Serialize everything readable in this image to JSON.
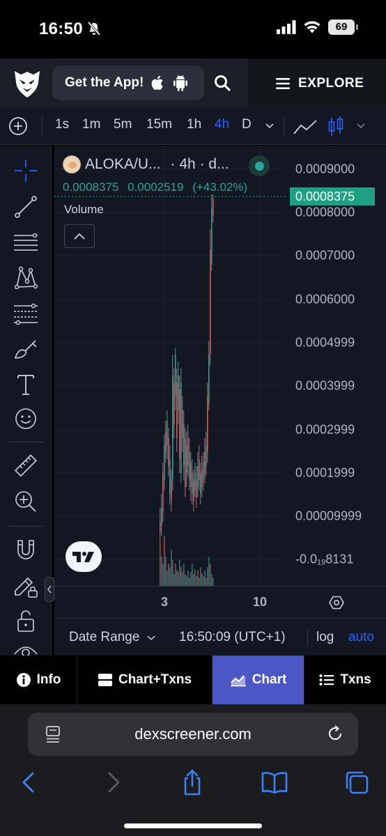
{
  "status_bar": {
    "time": "16:50",
    "battery": "69"
  },
  "header": {
    "get_app_label": "Get the App!",
    "explore_label": "EXPLORE"
  },
  "timeframes": {
    "items": [
      "1s",
      "1m",
      "5m",
      "15m",
      "1h",
      "4h",
      "D"
    ],
    "active": "4h"
  },
  "chart": {
    "symbol": "ALOKA/U...",
    "interval_meta": "· 4h · d...",
    "ohlc_close": "0.0008375",
    "change_abs": "0.0002519",
    "change_pct": "(+43.02%)",
    "volume_label": "Volume",
    "current_price": "0.0008375",
    "price_labels": [
      "0.0009000",
      "0.0008000",
      "0.0007000",
      "0.0006000",
      "0.0004999",
      "0.0003999",
      "0.0002999",
      "0.0001999",
      "0.00009999"
    ],
    "last_price_label_prefix": "-0.0",
    "last_price_label_sub": "19",
    "last_price_label_suffix": "8131",
    "time_labels": [
      "3",
      "10"
    ],
    "colors": {
      "up": "#26a69a",
      "down": "#ef5350",
      "active_tab": "#4a57c5",
      "accent": "#2962ff"
    }
  },
  "chart_data": {
    "type": "candlestick",
    "ylim": [
      -0.0001,
      0.00093
    ],
    "x_ticks": [
      "3",
      "10"
    ],
    "candles_description": "ALOKA/USDT 4h candles: range mostly 0.00010–0.00045, last candle surges to 0.0008375"
  },
  "chart_footer": {
    "date_range": "Date Range",
    "time": "16:50:09 (UTC+1)",
    "log": "log",
    "auto": "auto"
  },
  "tabs": [
    {
      "label": "Info",
      "icon": "info-icon"
    },
    {
      "label": "Chart+Txns",
      "icon": "split-icon"
    },
    {
      "label": "Chart",
      "icon": "chart-icon",
      "active": true
    },
    {
      "label": "Txns",
      "icon": "list-icon"
    }
  ],
  "browser": {
    "url": "dexscreener.com"
  }
}
